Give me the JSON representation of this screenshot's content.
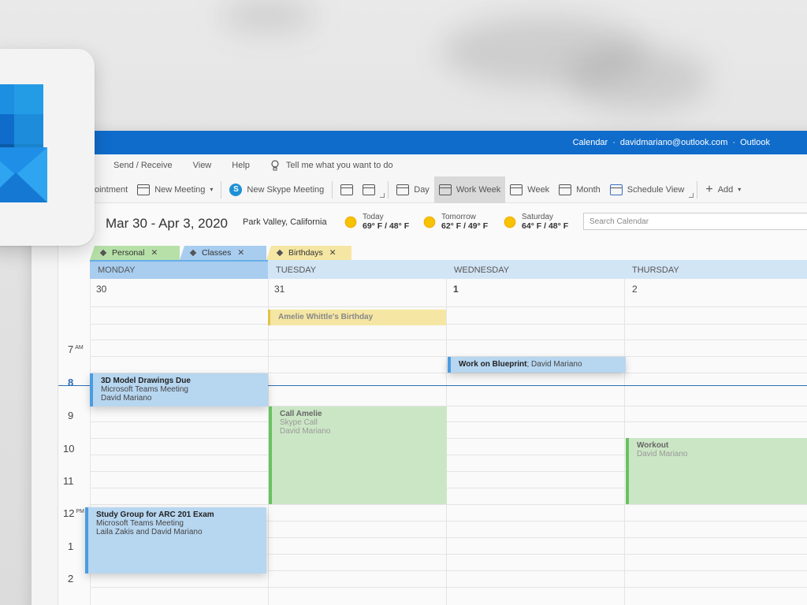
{
  "titlebar": {
    "section": "Calendar",
    "account": "davidmariano@outlook.com",
    "app": "Outlook"
  },
  "menu": {
    "send_receive": "Send / Receive",
    "view": "View",
    "help": "Help",
    "tell_me": "Tell me what you want to do"
  },
  "ribbon": {
    "appointment": "ointment",
    "new_meeting": "New Meeting",
    "new_skype": "New Skype Meeting",
    "day": "Day",
    "work_week": "Work Week",
    "week": "Week",
    "month": "Month",
    "schedule_view": "Schedule View",
    "add": "Add"
  },
  "header": {
    "date_range": "Mar 30 - Apr 3, 2020",
    "location": "Park Valley, California",
    "search_placeholder": "Search Calendar"
  },
  "weather": [
    {
      "label": "Today",
      "temp": "69° F / 48° F"
    },
    {
      "label": "Tomorrow",
      "temp": "62° F / 49° F"
    },
    {
      "label": "Saturday",
      "temp": "64° F / 48° F"
    }
  ],
  "calendars": [
    {
      "name": "Personal",
      "color": "#b7e0a9"
    },
    {
      "name": "Classes",
      "color": "#a8cdef"
    },
    {
      "name": "Birthdays",
      "color": "#f5e6a3"
    }
  ],
  "days": [
    {
      "name": "MONDAY",
      "num": "30"
    },
    {
      "name": "TUESDAY",
      "num": "31"
    },
    {
      "name": "WEDNESDAY",
      "num": "1"
    },
    {
      "name": "THURSDAY",
      "num": "2"
    }
  ],
  "hours": [
    {
      "h": "7",
      "ap": "AM"
    },
    {
      "h": "8",
      "ap": ""
    },
    {
      "h": "9",
      "ap": ""
    },
    {
      "h": "10",
      "ap": ""
    },
    {
      "h": "11",
      "ap": ""
    },
    {
      "h": "12",
      "ap": "PM"
    },
    {
      "h": "1",
      "ap": ""
    },
    {
      "h": "2",
      "ap": ""
    }
  ],
  "events": {
    "birthday": {
      "title": "Amelie Whittle's Birthday"
    },
    "blueprint": {
      "title": "Work on Blueprint",
      "organizer": "; David Mariano"
    },
    "model": {
      "title": "3D Model Drawings Due",
      "line2": "Microsoft Teams Meeting",
      "line3": "David Mariano"
    },
    "call": {
      "title": "Call Amelie",
      "line2": "Skype Call",
      "line3": "David Mariano"
    },
    "workout": {
      "title": "Workout",
      "line2": "David Mariano"
    },
    "study": {
      "title": "Study Group for ARC 201 Exam",
      "line2": "Microsoft Teams Meeting",
      "line3": "Laila Zakis and David Mariano"
    }
  },
  "colors": {
    "brand": "#0f6ccb",
    "classes": "#b7d6f0",
    "personal": "#cbe6c5",
    "birthday": "#f5e6a3"
  }
}
